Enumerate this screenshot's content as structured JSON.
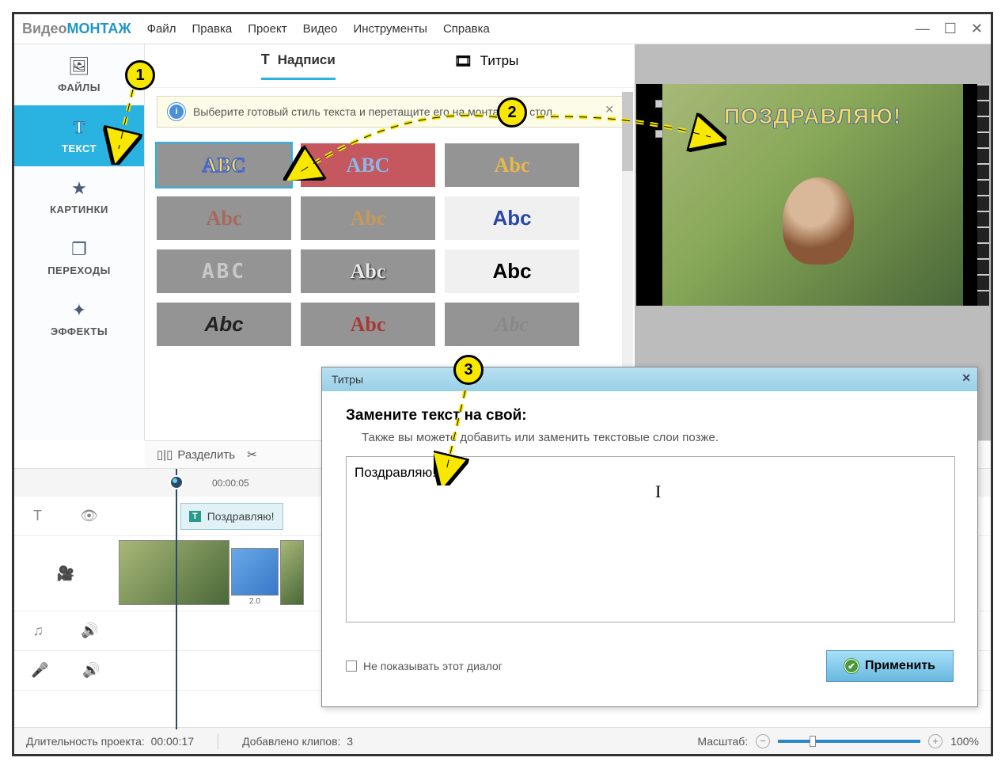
{
  "app": {
    "logo_a": "Видео",
    "logo_b": "МОНТАЖ"
  },
  "menu": {
    "file": "Файл",
    "edit": "Правка",
    "project": "Проект",
    "video": "Видео",
    "tools": "Инструменты",
    "help": "Справка"
  },
  "sidebar": {
    "files": "ФАЙЛЫ",
    "text": "ТЕКСТ",
    "pictures": "КАРТИНКИ",
    "transitions": "ПЕРЕХОДЫ",
    "effects": "ЭФФЕКТЫ"
  },
  "tabs": {
    "captions": "Надписи",
    "titles": "Титры"
  },
  "info": {
    "text": "Выберите готовый стиль текста и перетащите его на монтажный стол."
  },
  "styles": {
    "s1": "ABC",
    "s2": "ABC",
    "s3": "Abc",
    "s4": "Abc",
    "s5": "Abc",
    "s6": "Abc",
    "s7": "ABC",
    "s8": "Abc",
    "s9": "Abc",
    "s10": "Abc",
    "s11": "Abc",
    "s12": "Abc"
  },
  "preview": {
    "overlay_text": "ПОЗДРАВЛЯЮ!"
  },
  "toolbar": {
    "split": "Разделить"
  },
  "timeline": {
    "time1": "00:00:05",
    "text_clip": "Поздравляю!",
    "trans_dur": "2.0"
  },
  "status": {
    "duration_label": "Длительность проекта:",
    "duration_value": "00:00:17",
    "clips_label": "Добавлено клипов:",
    "clips_value": "3",
    "zoom_label": "Масштаб:",
    "zoom_value": "100%"
  },
  "dialog": {
    "title": "Титры",
    "heading": "Замените текст на свой:",
    "sub": "Также вы можете добавить или заменить текстовые слои позже.",
    "text_value": "Поздравляю!",
    "dont_show": "Не показывать этот диалог",
    "apply": "Применить"
  },
  "anno": {
    "b1": "1",
    "b2": "2",
    "b3": "3"
  }
}
